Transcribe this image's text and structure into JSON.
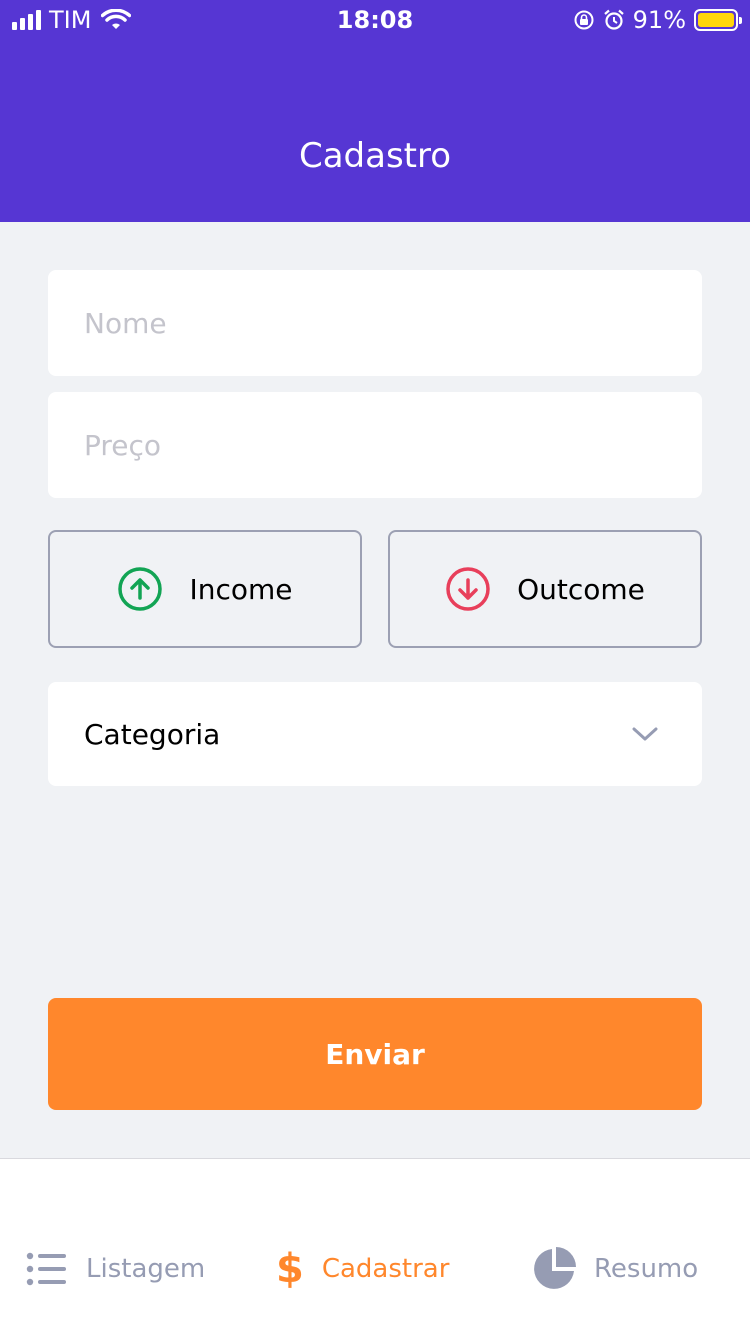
{
  "status_bar": {
    "carrier": "TIM",
    "time": "18:08",
    "battery": "91%"
  },
  "header": {
    "title": "Cadastro"
  },
  "form": {
    "name_placeholder": "Nome",
    "price_placeholder": "Preço",
    "income_label": "Income",
    "outcome_label": "Outcome",
    "category_label": "Categoria",
    "submit_label": "Enviar"
  },
  "tabs": [
    {
      "label": "Listagem",
      "icon": "list-icon"
    },
    {
      "label": "Cadastrar",
      "icon": "dollar-icon"
    },
    {
      "label": "Resumo",
      "icon": "pie-chart-icon"
    }
  ],
  "colors": {
    "primary": "#5636d3",
    "accent": "#ff872c",
    "income": "#12a454",
    "outcome": "#e83f5b",
    "inactive": "#969cb3"
  }
}
